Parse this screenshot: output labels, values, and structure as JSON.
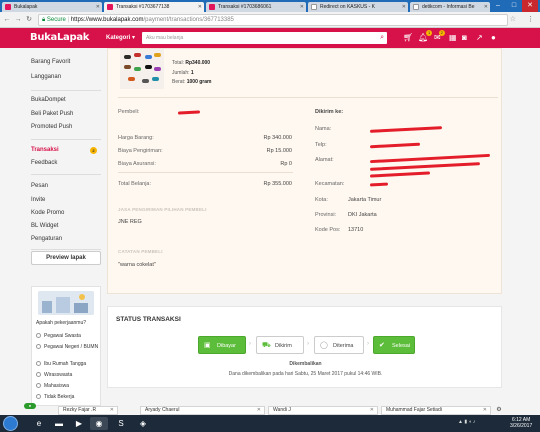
{
  "browser": {
    "tabs": [
      {
        "title": "Bukalapak",
        "active": false
      },
      {
        "title": "Transaksi #1703677138",
        "active": true
      },
      {
        "title": "Transaksi #1703686061",
        "active": false
      },
      {
        "title": "Redirect on KASKUS - K",
        "active": false
      },
      {
        "title": "detikcom - Informasi Be",
        "active": false
      }
    ],
    "secure_label": "Secure",
    "url_host": "https://www.bukalapak.com",
    "url_path": "/payment/transactions/367713385"
  },
  "header": {
    "logo": "BukaLapak",
    "kategori": "Kategori ▾",
    "search_placeholder": "Aku mau belanja",
    "notif_count": "1",
    "msg_count": "2"
  },
  "sidebar": {
    "items_top": [
      "Barang Favorit",
      "Langganan"
    ],
    "items_wallet": [
      "BukaDompet",
      "Beli Paket Push",
      "Promoted Push"
    ],
    "transaksi": "Transaksi",
    "transaksi_badge": "2",
    "feedback": "Feedback",
    "items_bottom": [
      "Pesan",
      "Invite",
      "Kode Promo",
      "BL Widget",
      "Pengaturan"
    ],
    "preview_button": "Preview lapak",
    "survey_question": "Apakah pekerjaanmu?",
    "survey_options": [
      "Pegawai Swasta",
      "Pegawai Negeri / BUMN",
      "Ibu Rumah Tangga",
      "Wirasswasta",
      "Mahasiswa",
      "Tidak Bekerja"
    ]
  },
  "product": {
    "total_label": "Total:",
    "total_value": "Rp340.000",
    "qty_label": "Jumlah:",
    "qty_value": "1",
    "weight_label": "Berat:",
    "weight_value": "1000 gram"
  },
  "order": {
    "buyer_label": "Pembeli:",
    "price_label": "Harga Barang:",
    "price_value": "Rp 340.000",
    "shipping_label": "Biaya Pengiriman:",
    "shipping_value": "Rp 15.000",
    "insurance_label": "Biaya Asuransi:",
    "insurance_value": "Rp 0",
    "total_label": "Total Belanja:",
    "total_value": "Rp 355.000",
    "courier_heading": "JASA PENGIRIMAN PILIHAN PEMBELI",
    "courier_value": "JNE REG",
    "notes_heading": "CATATAN PEMBELI",
    "notes_value": "\"warna cokelat\""
  },
  "shipto": {
    "heading": "Dikirim ke:",
    "name_label": "Nama:",
    "phone_label": "Telp:",
    "address_label": "Alamat:",
    "district_label": "Kecamatan:",
    "city_label": "Kota:",
    "city_value": "Jakarta Timur",
    "province_label": "Provinsi:",
    "province_value": "DKI Jakarta",
    "postal_label": "Kode Pos:",
    "postal_value": "13710"
  },
  "status": {
    "title": "STATUS TRANSAKSI",
    "steps": [
      "Dibayar",
      "Dikirim",
      "Diterima",
      "Selesai"
    ],
    "state": "Dikembalikan",
    "detail": "Dana dikembalikan pada hari Sabtu, 25 Maret 2017 pukul 14:46 WIB."
  },
  "chats": [
    "Rezky Fajar .R",
    "Aryady Chaerul",
    "Wandi J",
    "Muhammad Fajar Setiadi"
  ],
  "taskbar": {
    "time": "6:12 AM",
    "date": "3/26/2017"
  },
  "colors": {
    "brand": "#d71149",
    "done": "#5cbd3a",
    "badge": "#f7b500"
  }
}
